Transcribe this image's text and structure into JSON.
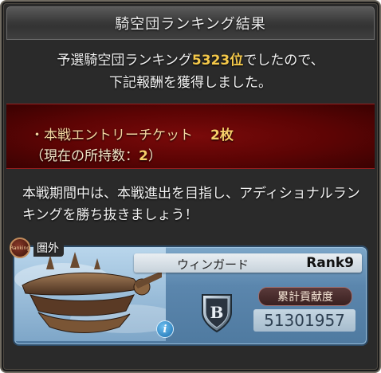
{
  "dialog": {
    "title": "騎空団ランキング結果",
    "intro_prefix": "予選騎空団ランキング",
    "intro_rank": "5323位",
    "intro_suffix": "でしたので、",
    "intro_line2": "下記報酬を獲得しました。",
    "reward_prefix": "・本戦エントリーチケット",
    "reward_qty": "2枚",
    "possession_prefix": "（現在の所持数：",
    "possession_value": "2",
    "possession_suffix": "）",
    "body_text": "本戦期間中は、本戦進出を目指し、アディショナルランキングを勝ち抜きましょう！"
  },
  "crew_card": {
    "emblem_text": "Ranking",
    "rank_status": "圏外",
    "crew_name": "ウィンガード",
    "crew_rank": "Rank9",
    "crest_letter": "B",
    "info_symbol": "i",
    "contribution_label": "累計貢献度",
    "contribution_value": "51301957"
  },
  "colors": {
    "highlight_gold": "#f5c94a",
    "reward_band": "#6a0606",
    "card_blue": "#5b86ad"
  }
}
